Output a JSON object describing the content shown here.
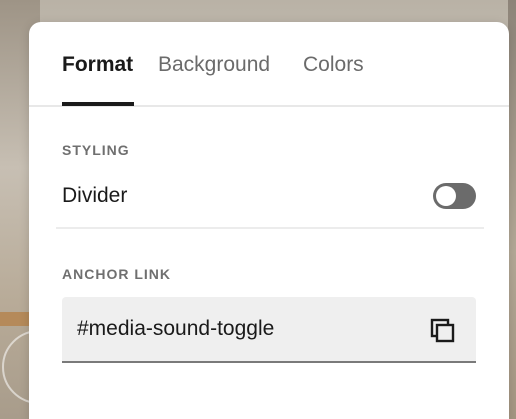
{
  "tabs": [
    {
      "label": "Format",
      "active": true
    },
    {
      "label": "Background",
      "active": false
    },
    {
      "label": "Colors",
      "active": false
    }
  ],
  "styling": {
    "section_label": "STYLING",
    "divider_label": "Divider",
    "divider_enabled": false
  },
  "anchor": {
    "section_label": "ANCHOR LINK",
    "value": "#media-sound-toggle",
    "copy_icon": "copy-icon"
  },
  "colors": {
    "text": "#1a1a1a",
    "muted": "#6b6b6b",
    "toggle_off": "#6b6b6b",
    "field_bg": "#efefef"
  }
}
